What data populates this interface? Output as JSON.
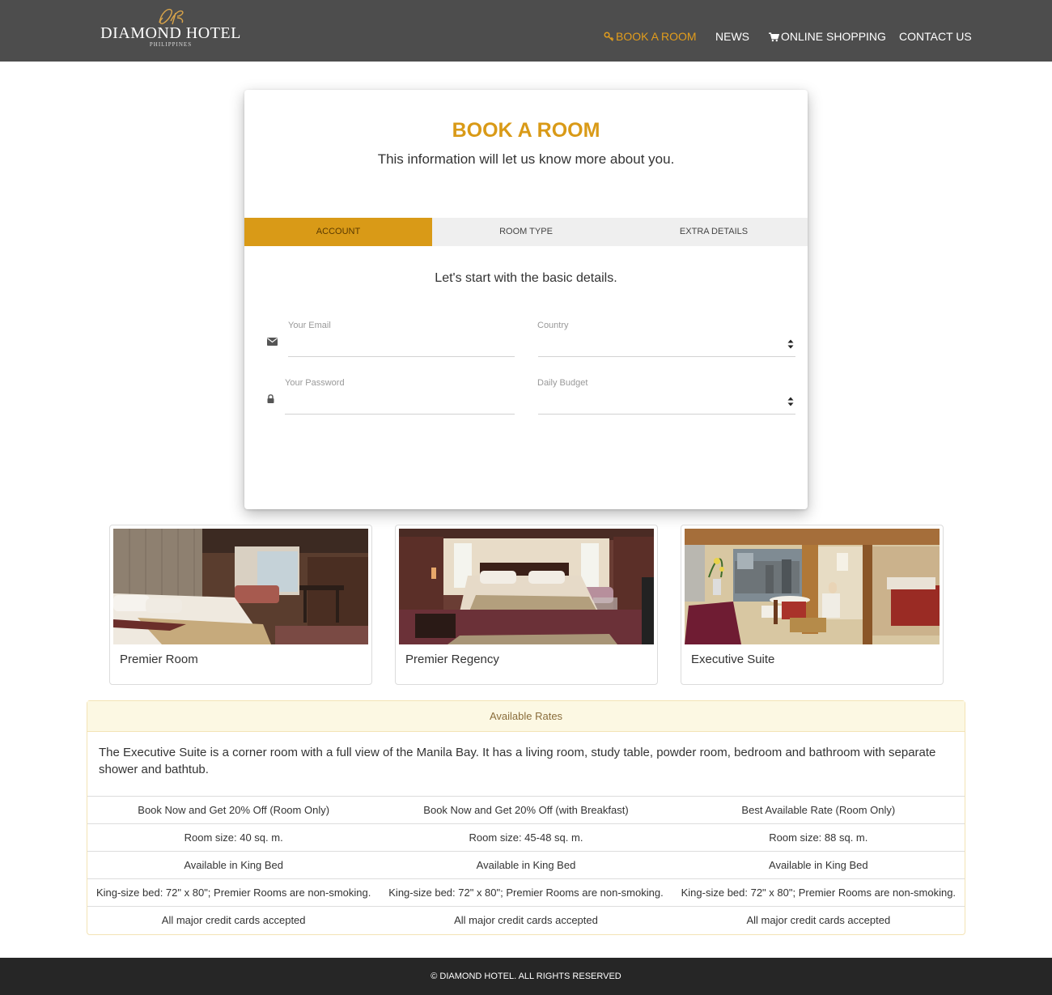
{
  "brand": {
    "name": "DIAMOND HOTEL",
    "sub": "PHILIPPINES",
    "monogram": "DH",
    "gold": "#d99a17"
  },
  "nav": {
    "items": [
      {
        "label": "BOOK A ROOM",
        "icon": "key-icon",
        "active": true
      },
      {
        "label": "NEWS",
        "icon": null,
        "active": false
      },
      {
        "label": "ONLINE SHOPPING",
        "icon": "cart-icon",
        "active": false
      },
      {
        "label": "CONTACT US",
        "icon": null,
        "active": false
      }
    ]
  },
  "booking": {
    "title": "BOOK A ROOM",
    "subtitle": "This information will let us know more about you.",
    "tabs": [
      {
        "label": "ACCOUNT",
        "active": true
      },
      {
        "label": "ROOM TYPE",
        "active": false
      },
      {
        "label": "EXTRA DETAILS",
        "active": false
      }
    ],
    "step_text": "Let's start with the basic details.",
    "fields": {
      "email_label": "Your Email",
      "email_value": "",
      "password_label": "Your Password",
      "password_value": "",
      "country_label": "Country",
      "country_value": "",
      "budget_label": "Daily Budget",
      "budget_value": ""
    }
  },
  "rooms": [
    {
      "name": "Premier Room"
    },
    {
      "name": "Premier Regency"
    },
    {
      "name": "Executive Suite"
    }
  ],
  "rates": {
    "heading": "Available Rates",
    "description": "The Executive Suite is a corner room with a full view of the Manila Bay. It has a living room, study table, powder room, bedroom and bathroom with separate shower and bathtub.",
    "rows": [
      [
        "Book Now and Get 20% Off (Room Only)",
        "Book Now and Get 20% Off (with Breakfast)",
        "Best Available Rate (Room Only)"
      ],
      [
        "Room size: 40 sq. m.",
        "Room size: 45-48 sq. m.",
        "Room size: 88 sq. m."
      ],
      [
        "Available in King Bed",
        "Available in King Bed",
        "Available in King Bed"
      ],
      [
        "King-size bed: 72\" x 80\"; Premier Rooms are non-smoking.",
        "King-size bed: 72\" x 80\"; Premier Rooms are non-smoking.",
        "King-size bed: 72\" x 80\"; Premier Rooms are non-smoking."
      ],
      [
        "All major credit cards accepted",
        "All major credit cards accepted",
        "All major credit cards accepted"
      ]
    ]
  },
  "footer": {
    "text": "© DIAMOND HOTEL. ALL RIGHTS RESERVED"
  }
}
